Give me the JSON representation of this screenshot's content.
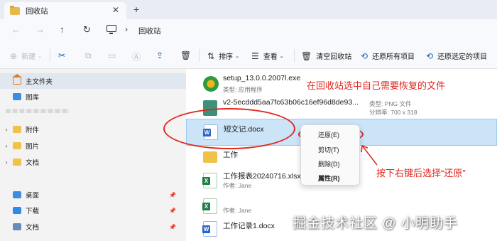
{
  "window": {
    "tab_title": "回收站",
    "tab_close": "✕",
    "tab_add": "+"
  },
  "address": {
    "back": "←",
    "forward": "→",
    "up": "↑",
    "refresh": "↻",
    "separator": "›",
    "path": "回收站"
  },
  "toolbar": {
    "new_label": "新建",
    "sort_label": "排序",
    "view_label": "查看",
    "empty_label": "清空回收站",
    "restore_all_label": "还原所有项目",
    "restore_selected_label": "还原选定的项目"
  },
  "sidebar": {
    "items": [
      {
        "label": "主文件夹",
        "icon": "home-icon"
      },
      {
        "label": "图库",
        "icon": "gallery-icon"
      },
      {
        "label": "附件",
        "icon": "folder-icon"
      },
      {
        "label": "图片",
        "icon": "folder-icon"
      },
      {
        "label": "文档",
        "icon": "folder-icon"
      },
      {
        "label": "桌面",
        "icon": "desktop-icon"
      },
      {
        "label": "下载",
        "icon": "download-icon"
      },
      {
        "label": "文档",
        "icon": "documents-icon"
      }
    ]
  },
  "files": [
    {
      "name": "setup_13.0.0.2007l.exe",
      "sub": "类型: 应用程序",
      "meta": ""
    },
    {
      "name": "v2-5ecddd5aa7fc63b06c16ef96d8de93...",
      "sub": "",
      "meta1": "类型: PNG 文件",
      "meta2": "分辨率: 700 x 318"
    },
    {
      "name": "短文记.docx",
      "sub": ""
    },
    {
      "name": "工作",
      "sub": ""
    },
    {
      "name": "工作报表20240716.xlsx",
      "sub": "作者: Jane"
    },
    {
      "name": "",
      "sub": "作者: Jane"
    },
    {
      "name": "工作记录1.docx",
      "sub": ""
    }
  ],
  "context_menu": {
    "restore": "还原(E)",
    "cut": "剪切(T)",
    "delete": "删除(D)",
    "properties": "属性(R)"
  },
  "annotations": {
    "top_note": "在回收站选中自己需要恢复的文件",
    "right_note": "按下右键后选择“还原”",
    "watermark": "掘金技术社区 @ 小明助手"
  },
  "colors": {
    "annotation": "#e0271f",
    "selection": "#cce4f7",
    "accent": "#1a63b8"
  }
}
